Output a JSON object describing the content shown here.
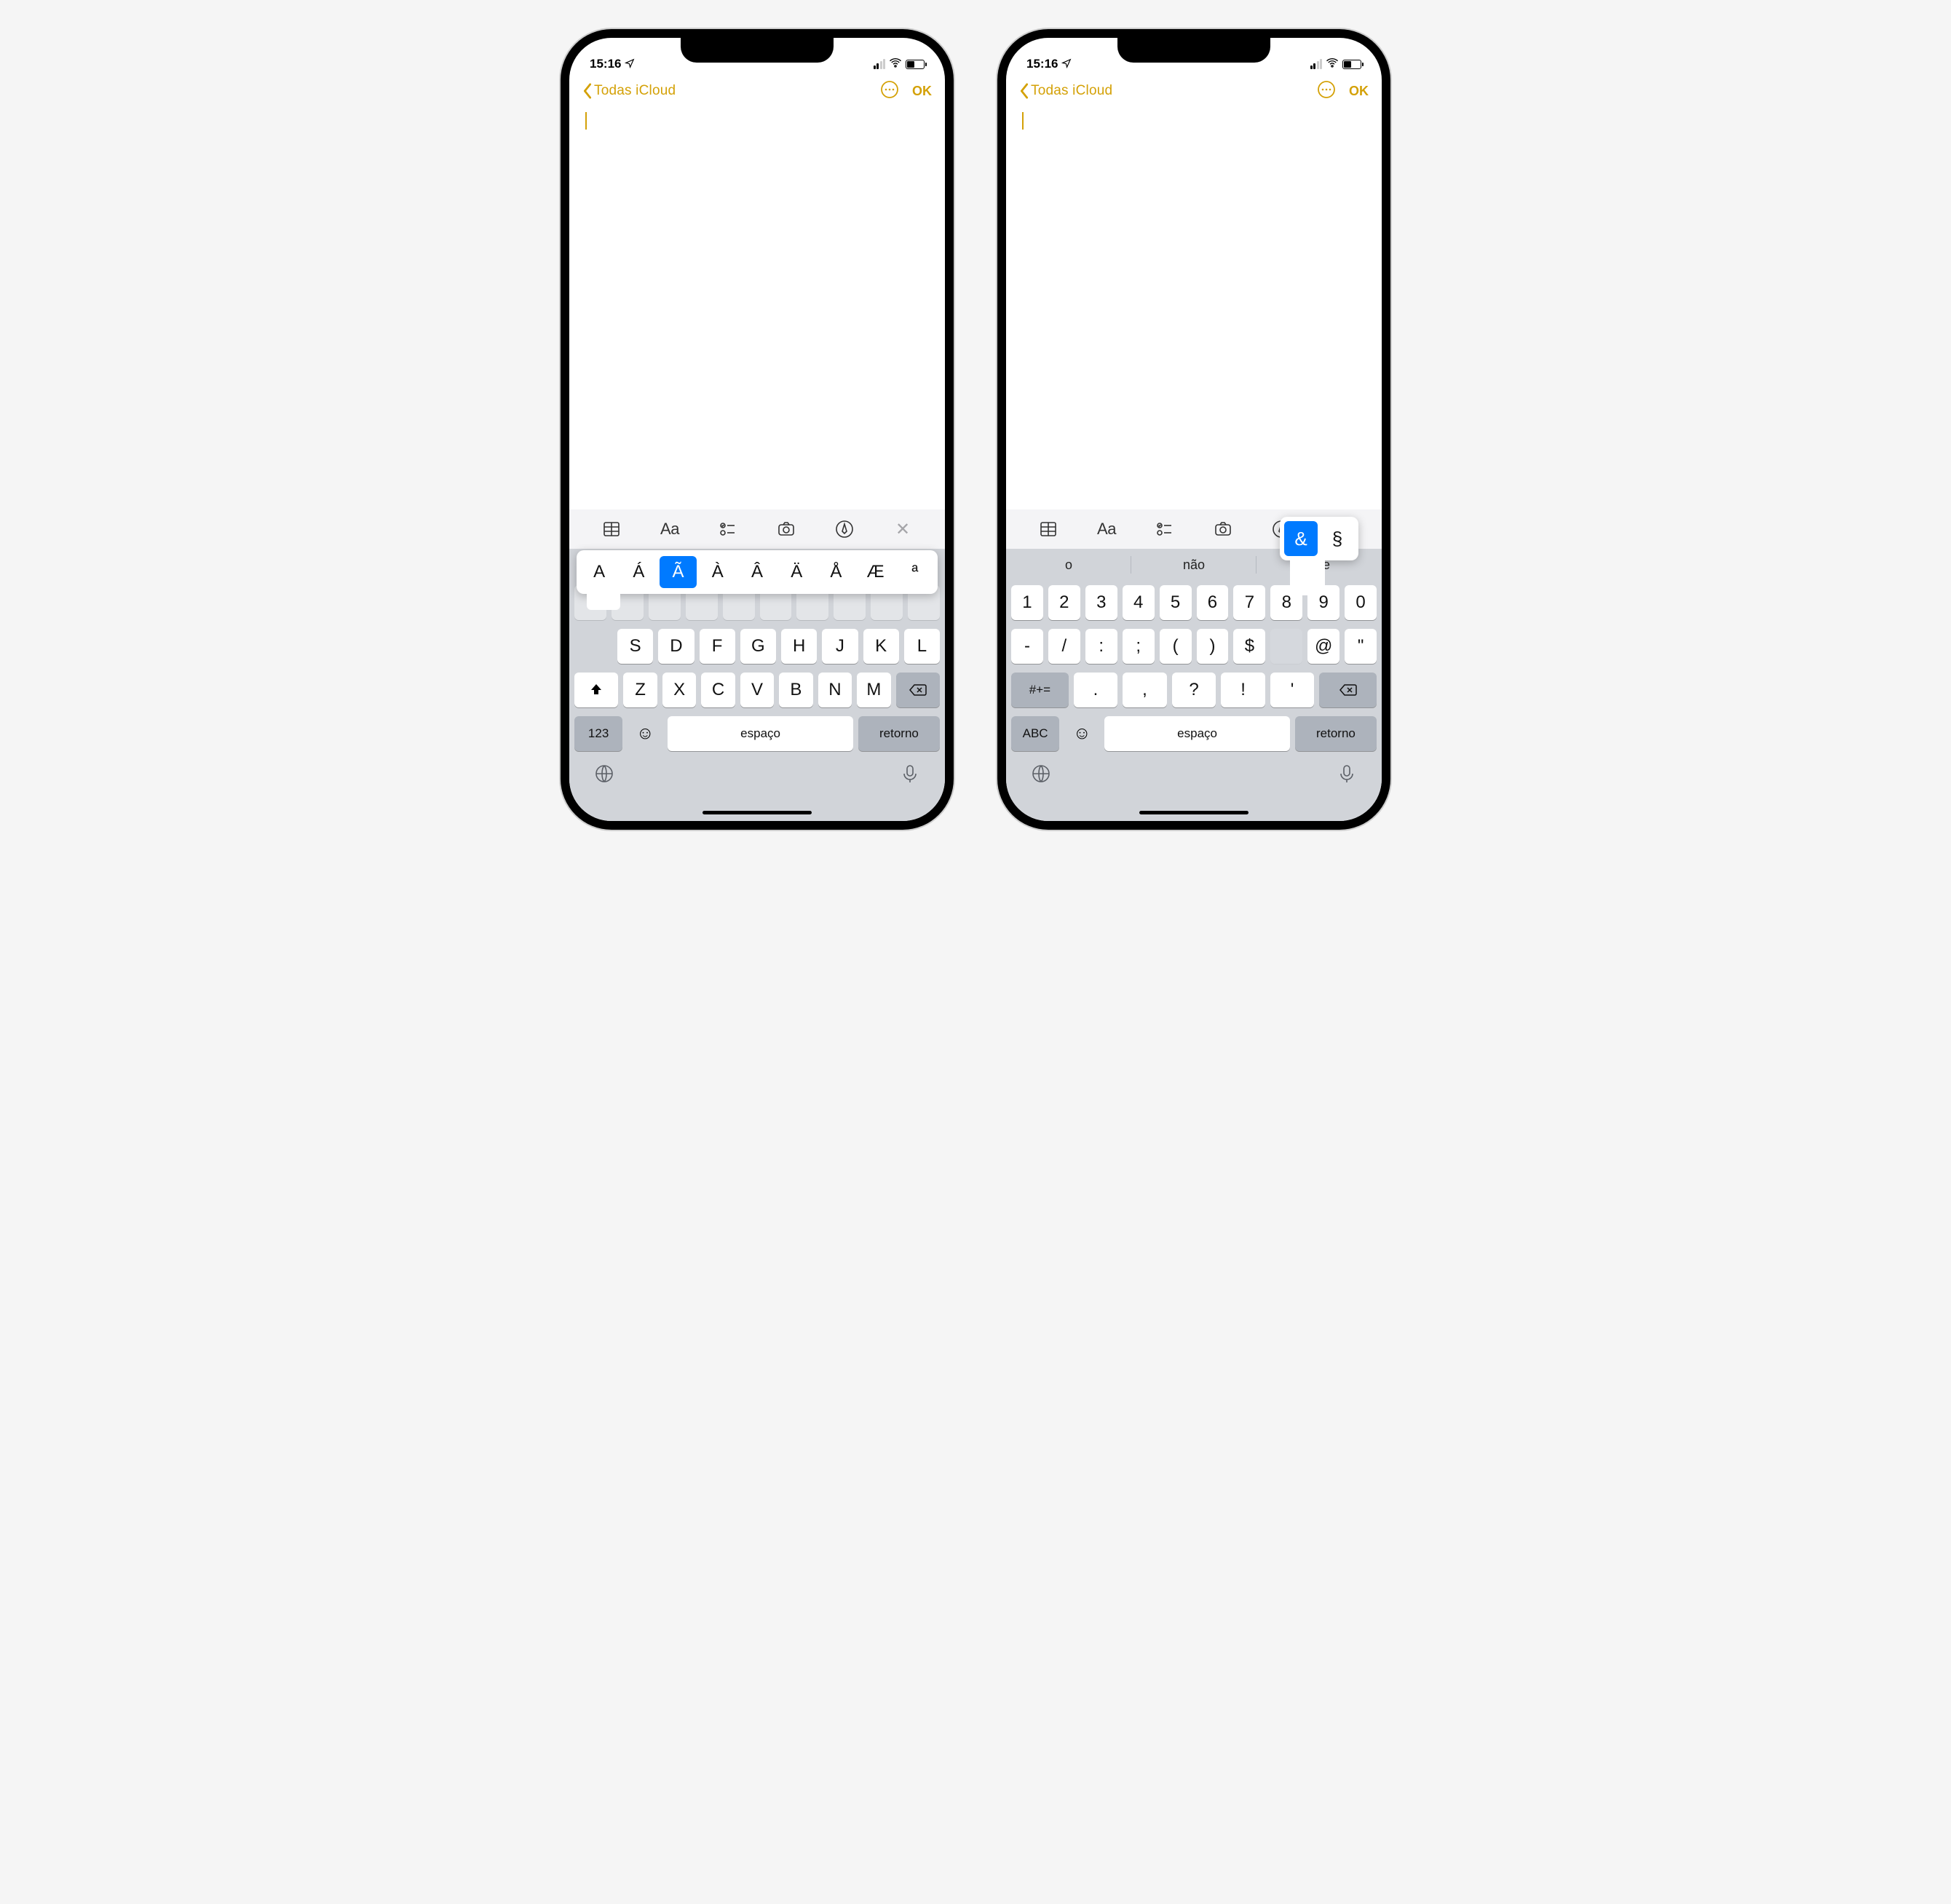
{
  "status": {
    "time": "15:16"
  },
  "nav": {
    "back": "Todas iCloud",
    "ok": "OK"
  },
  "toolbar": {
    "aa": "Aa"
  },
  "left": {
    "suggest": [
      "",
      "",
      ""
    ],
    "accents": [
      "A",
      "Á",
      "Ã",
      "À",
      "Â",
      "Ä",
      "Å",
      "Æ",
      "ª"
    ],
    "accents_sel_index": 2,
    "row2": [
      "S",
      "D",
      "F",
      "G",
      "H",
      "J",
      "K",
      "L"
    ],
    "row3": [
      "Z",
      "X",
      "C",
      "V",
      "B",
      "N",
      "M"
    ],
    "k123": "123",
    "space": "espaço",
    "return": "retorno"
  },
  "right": {
    "suggest": [
      "o",
      "não",
      "que"
    ],
    "row1": [
      "1",
      "2",
      "3",
      "4",
      "5",
      "6",
      "7",
      "8",
      "9",
      "0"
    ],
    "pop": [
      "&",
      "§"
    ],
    "pop_sel_index": 0,
    "row2": [
      "-",
      "/",
      ":",
      ";",
      "(",
      ")",
      "$",
      "",
      "@",
      "\""
    ],
    "row3": [
      ".",
      ",",
      "?",
      "!",
      "'"
    ],
    "sym": "#+=",
    "abc": "ABC",
    "space": "espaço",
    "return": "retorno"
  }
}
